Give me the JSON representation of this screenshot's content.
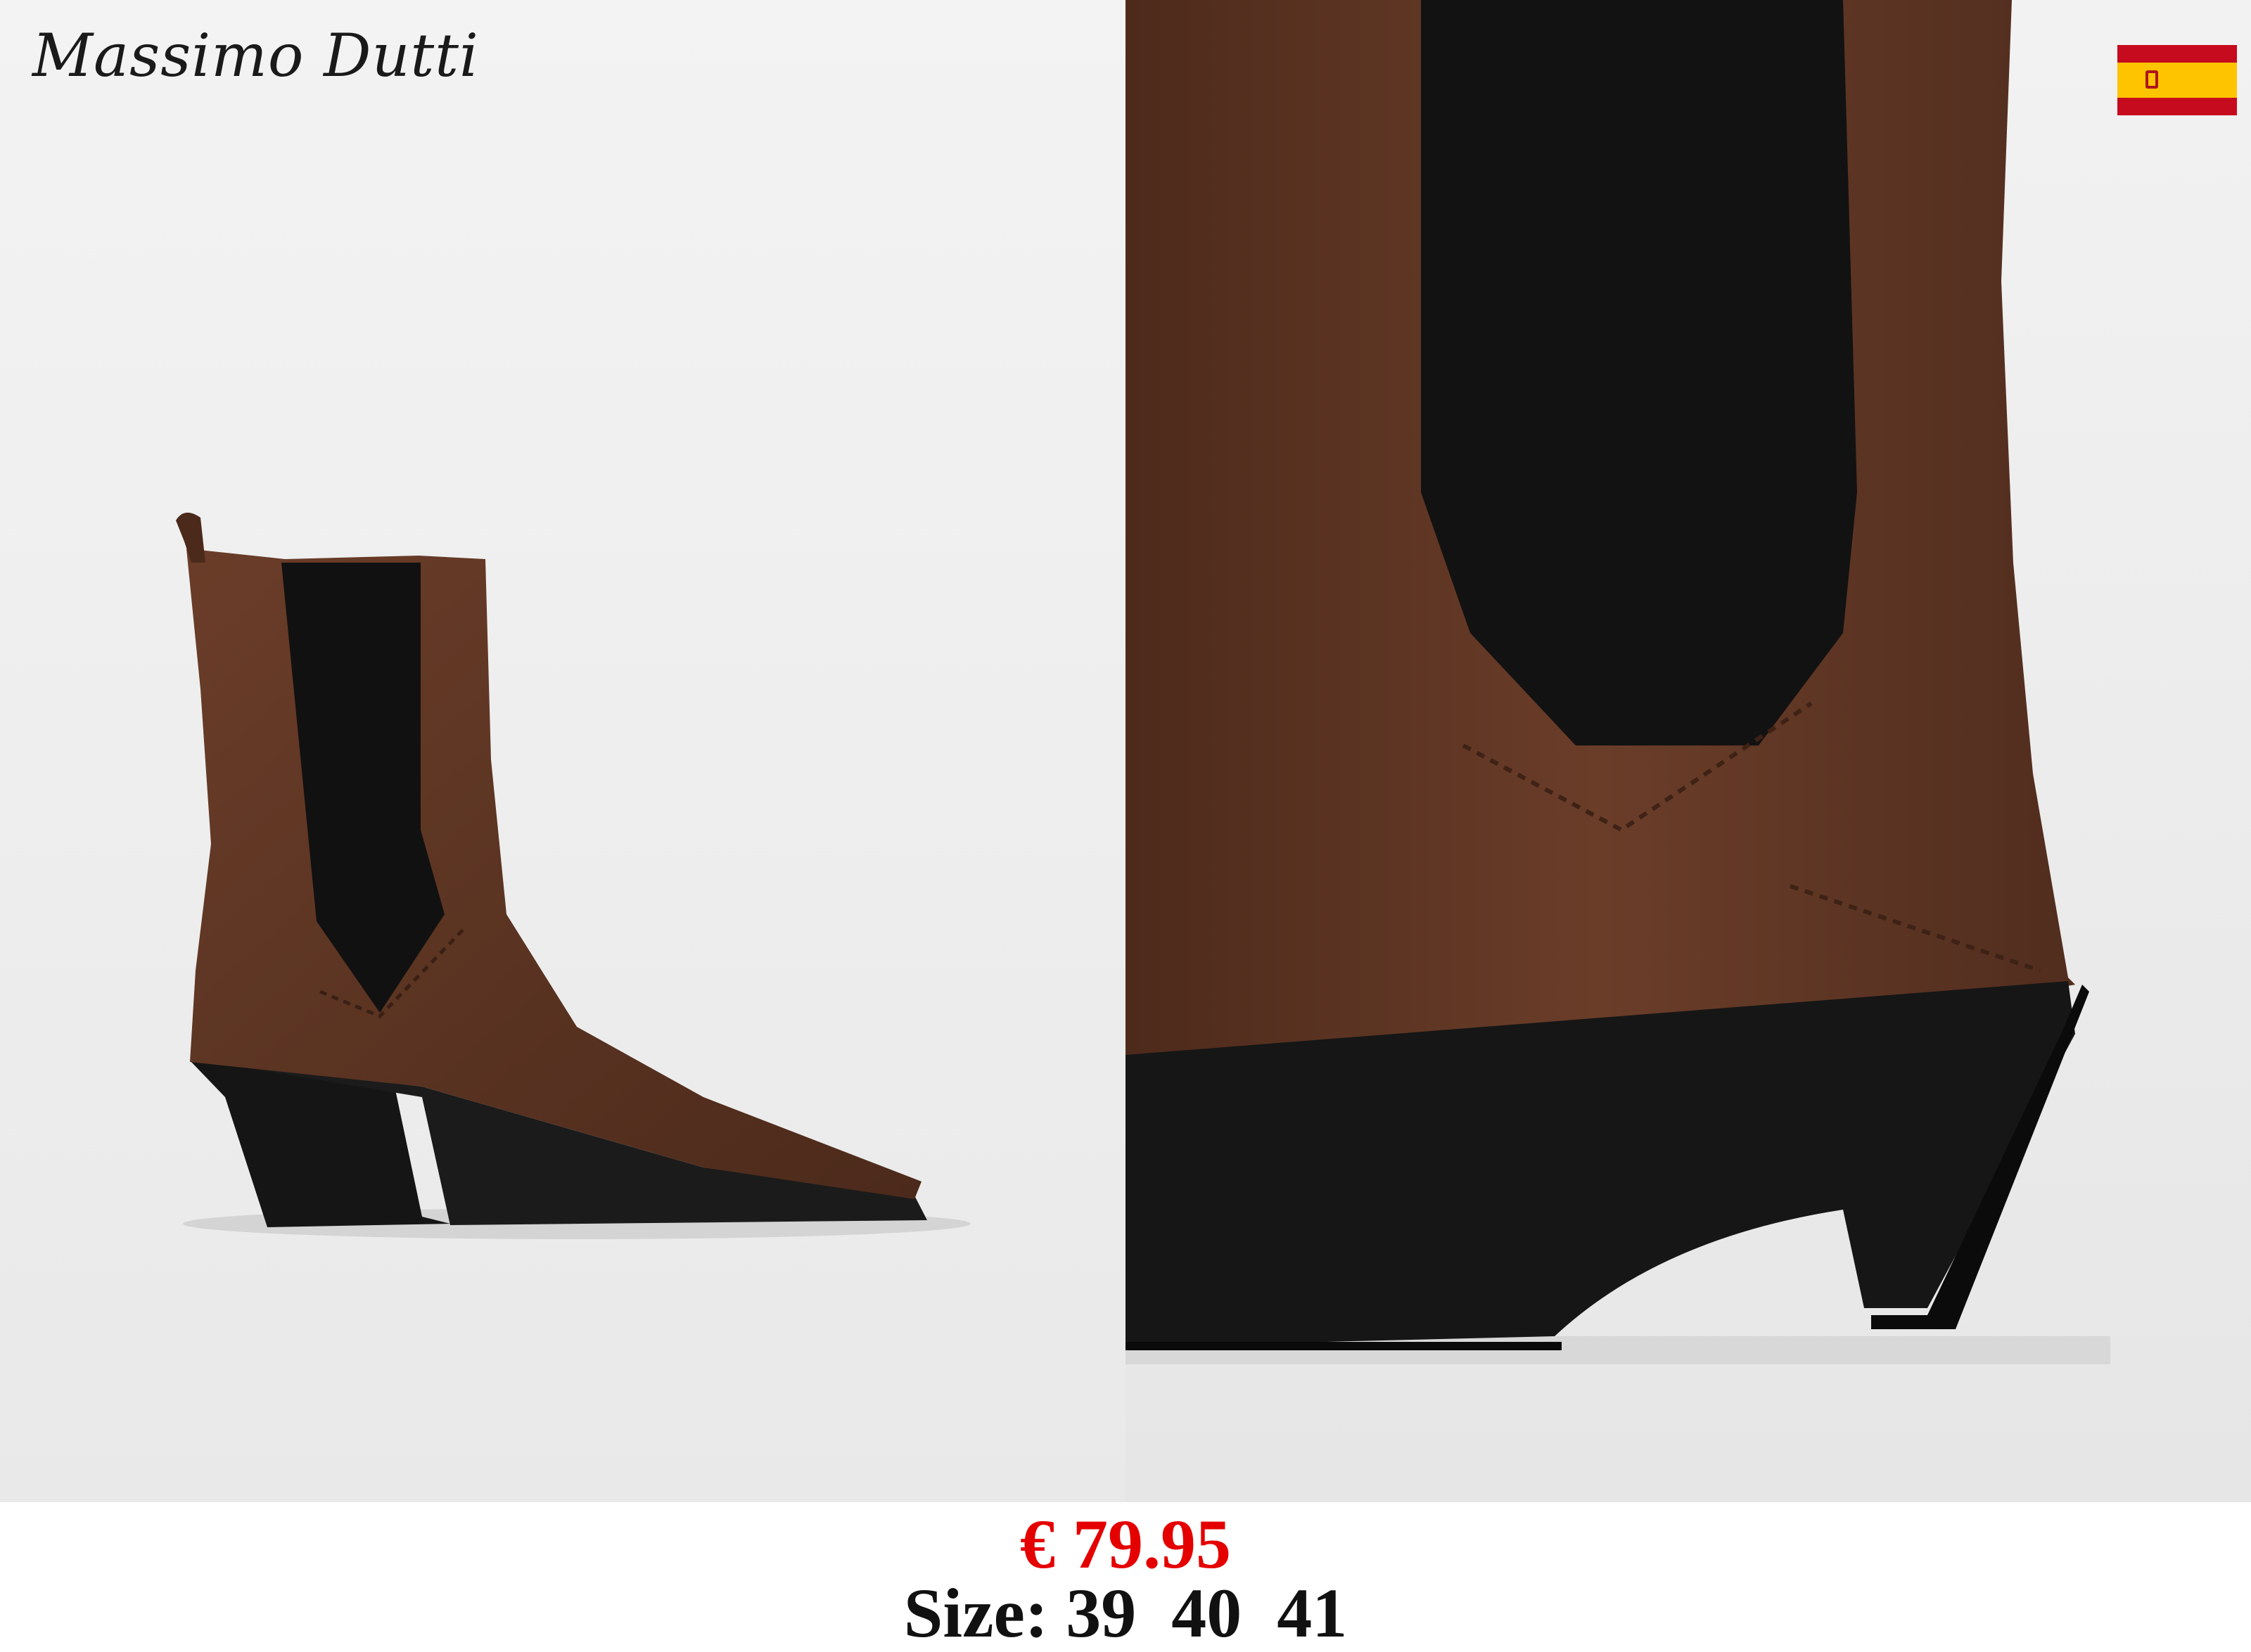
{
  "brand": {
    "name": "Massimo Dutti"
  },
  "country_flag": {
    "icon": "spain-flag-icon",
    "colors": [
      "#c60b1e",
      "#ffc400"
    ]
  },
  "product": {
    "price": "€ 79.95",
    "size_label": "Size:",
    "sizes": [
      "39",
      "40",
      "41"
    ],
    "price_color": "#e50000"
  },
  "images": [
    {
      "name": "boot-side-view",
      "color": "#5a3322"
    },
    {
      "name": "boot-heel-closeup",
      "color": "#5a3322"
    }
  ]
}
